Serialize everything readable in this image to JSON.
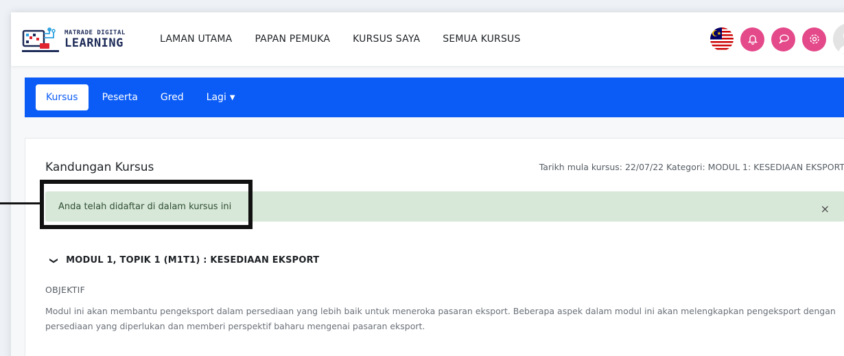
{
  "brand": {
    "small": "MATRADE DIGITAL",
    "big": "LEARNING"
  },
  "nav": {
    "items": [
      {
        "label": "LAMAN UTAMA"
      },
      {
        "label": "PAPAN PEMUKA"
      },
      {
        "label": "KURSUS SAYA"
      },
      {
        "label": "SEMUA KURSUS"
      }
    ],
    "icons": [
      "malaysia-flag-icon",
      "bell-icon",
      "chat-icon",
      "gear-icon",
      "user-avatar"
    ],
    "accent_color": "#e4498a"
  },
  "secondary_nav": {
    "items": [
      {
        "label": "Kursus",
        "active": true
      },
      {
        "label": "Peserta"
      },
      {
        "label": "Gred"
      },
      {
        "label": "Lagi"
      }
    ],
    "background": "#0b5cf6"
  },
  "content": {
    "title": "Kandungan Kursus",
    "meta": "Tarikh mula kursus: 22/07/22   Kategori: MODUL 1: KESEDIAAN EKSPORT",
    "alert": {
      "text": "Anda telah didaftar di dalam kursus ini",
      "close": "×"
    },
    "section": {
      "title": "MODUL 1, TOPIK 1 (M1T1) : KESEDIAAN EKSPORT"
    },
    "objective_label": "OBJEKTIF",
    "objective_text": "Modul ini akan membantu pengeksport dalam persediaan yang lebih baik untuk meneroka pasaran eksport. Beberapa aspek dalam modul ini akan melengkapkan pengeksport dengan persediaan yang diperlukan dan memberi perspektif baharu mengenai pasaran eksport."
  }
}
